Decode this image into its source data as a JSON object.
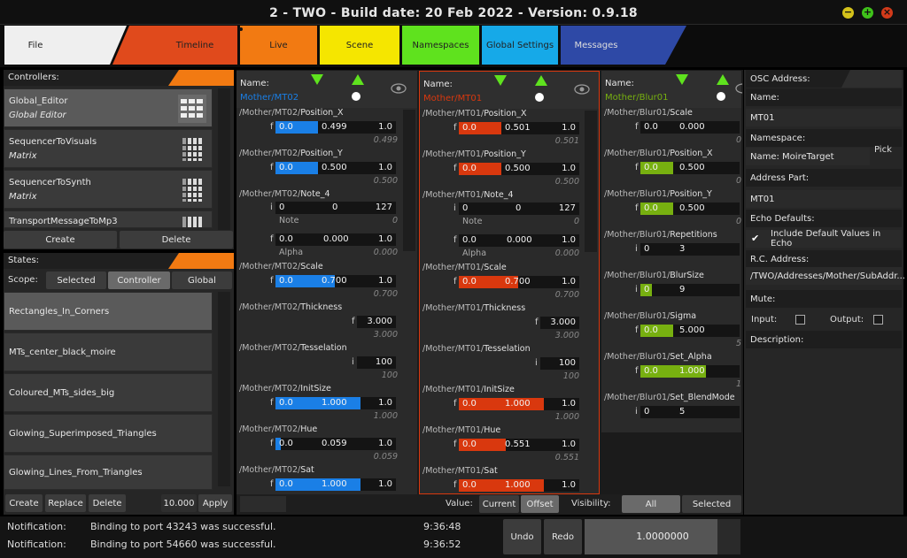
{
  "window": {
    "title": "2 - TWO - Build date: 20 Feb 2022 - Version: 0.9.18"
  },
  "tabs": [
    {
      "label": "File",
      "color": "#efefef"
    },
    {
      "label": "Timeline",
      "color": "#e04a1c"
    },
    {
      "label": "Live",
      "color": "#f27a12"
    },
    {
      "label": "Scene",
      "color": "#f5e600"
    },
    {
      "label": "Namespaces",
      "color": "#5fe21e"
    },
    {
      "label": "Global Settings",
      "color": "#16a9e8"
    },
    {
      "label": "Messages",
      "color": "#2e49a6"
    }
  ],
  "controllers": {
    "header": "Controllers:",
    "items": [
      {
        "name": "Global_Editor",
        "sub": "Global Editor"
      },
      {
        "name": "SequencerToVisuals",
        "sub": "Matrix"
      },
      {
        "name": "SequencerToSynth",
        "sub": "Matrix"
      },
      {
        "name": "TransportMessageToMp3",
        "sub": ""
      }
    ],
    "create": "Create",
    "delete": "Delete"
  },
  "states": {
    "header": "States:",
    "scope_label": "Scope:",
    "scopes": [
      "Selected",
      "Controller",
      "Global"
    ],
    "items": [
      "Rectangles_In_Corners",
      "MTs_center_black_moire",
      "Coloured_MTs_sides_big",
      "Glowing_Superimposed_Triangles",
      "Glowing_Lines_From_Triangles"
    ],
    "buttons": {
      "create": "Create",
      "replace": "Replace",
      "delete": "Delete",
      "value": "10.000",
      "apply": "Apply"
    }
  },
  "columns": [
    {
      "name_label": "Name:",
      "name": "Mother/MT02",
      "accent": "#1a7fe6",
      "params": [
        {
          "path": "/Mother/MT02/",
          "param": "Position_X",
          "type": "f",
          "min": "0.0",
          "val": "0.499",
          "max": "1.0",
          "sub": "0.499",
          "fill": 0.499
        },
        {
          "path": "/Mother/MT02/",
          "param": "Position_Y",
          "type": "f",
          "min": "0.0",
          "val": "0.500",
          "max": "1.0",
          "sub": "0.500",
          "fill": 0.5
        },
        {
          "path": "/Mother/MT02/",
          "param": "Note_4",
          "note": true
        },
        {
          "path": "/Mother/MT02/",
          "param": "Scale",
          "type": "f",
          "min": "0.0",
          "val": "0.700",
          "max": "1.0",
          "sub": "0.700",
          "fill": 0.7
        },
        {
          "path": "/Mother/MT02/",
          "param": "Thickness",
          "single": true,
          "type": "f",
          "val": "3.000",
          "sub": "3.000"
        },
        {
          "path": "/Mother/MT02/",
          "param": "Tesselation",
          "single": true,
          "type": "i",
          "val": "100",
          "sub": "100"
        },
        {
          "path": "/Mother/MT02/",
          "param": "InitSize",
          "type": "f",
          "min": "0.0",
          "val": "1.000",
          "max": "1.0",
          "sub": "1.000",
          "fill": 1.0
        },
        {
          "path": "/Mother/MT02/",
          "param": "Hue",
          "type": "f",
          "min": "0.0",
          "val": "0.059",
          "max": "1.0",
          "sub": "0.059",
          "fill": 0.059
        },
        {
          "path": "/Mother/MT02/",
          "param": "Sat",
          "type": "f",
          "min": "0.0",
          "val": "1.000",
          "max": "1.0",
          "sub": "",
          "fill": 1.0
        }
      ],
      "note": {
        "i": "i",
        "a": "0",
        "b": "0",
        "c": "127",
        "note_label": "Note",
        "note_sub": "0",
        "f": "f",
        "fa": "0.0",
        "fb": "0.000",
        "fc": "1.0",
        "alpha_label": "Alpha",
        "alpha_sub": "0.000"
      }
    },
    {
      "name_label": "Name:",
      "name": "Mother/MT01",
      "accent": "#d9380e",
      "params": [
        {
          "path": "/Mother/MT01/",
          "param": "Position_X",
          "type": "f",
          "min": "0.0",
          "val": "0.501",
          "max": "1.0",
          "sub": "0.501",
          "fill": 0.501
        },
        {
          "path": "/Mother/MT01/",
          "param": "Position_Y",
          "type": "f",
          "min": "0.0",
          "val": "0.500",
          "max": "1.0",
          "sub": "0.500",
          "fill": 0.5
        },
        {
          "path": "/Mother/MT01/",
          "param": "Note_4",
          "note": true
        },
        {
          "path": "/Mother/MT01/",
          "param": "Scale",
          "type": "f",
          "min": "0.0",
          "val": "0.700",
          "max": "1.0",
          "sub": "0.700",
          "fill": 0.7
        },
        {
          "path": "/Mother/MT01/",
          "param": "Thickness",
          "single": true,
          "type": "f",
          "val": "3.000",
          "sub": "3.000"
        },
        {
          "path": "/Mother/MT01/",
          "param": "Tesselation",
          "single": true,
          "type": "i",
          "val": "100",
          "sub": "100"
        },
        {
          "path": "/Mother/MT01/",
          "param": "InitSize",
          "type": "f",
          "min": "0.0",
          "val": "1.000",
          "max": "1.0",
          "sub": "1.000",
          "fill": 1.0
        },
        {
          "path": "/Mother/MT01/",
          "param": "Hue",
          "type": "f",
          "min": "0.0",
          "val": "0.551",
          "max": "1.0",
          "sub": "0.551",
          "fill": 0.551
        },
        {
          "path": "/Mother/MT01/",
          "param": "Sat",
          "type": "f",
          "min": "0.0",
          "val": "1.000",
          "max": "1.0",
          "sub": "",
          "fill": 1.0
        }
      ],
      "note": {
        "i": "i",
        "a": "0",
        "b": "0",
        "c": "127",
        "note_label": "Note",
        "note_sub": "0",
        "f": "f",
        "fa": "0.0",
        "fb": "0.000",
        "fc": "1.0",
        "alpha_label": "Alpha",
        "alpha_sub": "0.000"
      }
    },
    {
      "name_label": "Name:",
      "name": "Mother/Blur01",
      "accent": "#77b010",
      "params": [
        {
          "path": "/Mother/Blur01/",
          "param": "Scale",
          "type": "f",
          "min": "0.0",
          "val": "0.000",
          "max": "",
          "sub": "0",
          "fill": 0.0
        },
        {
          "path": "/Mother/Blur01/",
          "param": "Position_X",
          "type": "f",
          "min": "0.0",
          "val": "0.500",
          "max": "",
          "sub": "0",
          "fill": 0.5
        },
        {
          "path": "/Mother/Blur01/",
          "param": "Position_Y",
          "type": "f",
          "min": "0.0",
          "val": "0.500",
          "max": "",
          "sub": "0",
          "fill": 0.5
        },
        {
          "path": "/Mother/Blur01/",
          "param": "Repetitions",
          "type": "i",
          "min": "0",
          "val": "3",
          "max": "",
          "sub": "",
          "fill": 0.0
        },
        {
          "path": "/Mother/Blur01/",
          "param": "BlurSize",
          "type": "i",
          "min": "0",
          "val": "9",
          "max": "",
          "sub": "",
          "fill": 0.18
        },
        {
          "path": "/Mother/Blur01/",
          "param": "Sigma",
          "type": "f",
          "min": "0.0",
          "val": "5.000",
          "max": "",
          "sub": "5",
          "fill": 0.5
        },
        {
          "path": "/Mother/Blur01/",
          "param": "Set_Alpha",
          "type": "f",
          "min": "0.0",
          "val": "1.000",
          "max": "",
          "sub": "1",
          "fill": 1.0
        },
        {
          "path": "/Mother/Blur01/",
          "param": "Set_BlendMode",
          "type": "i",
          "min": "0",
          "val": "5",
          "max": "",
          "sub": "",
          "fill": 0.0
        }
      ]
    }
  ],
  "bottom_controls": {
    "value_label": "Value:",
    "current": "Current",
    "offset": "Offset",
    "visibility_label": "Visibility:",
    "all": "All",
    "selected": "Selected"
  },
  "notifications": [
    {
      "label": "Notification:",
      "text": "Binding to port 43243 was successful.",
      "time": "9:36:48"
    },
    {
      "label": "Notification:",
      "text": "Binding to port 54660 was successful.",
      "time": "9:36:52"
    }
  ],
  "undo": "Undo",
  "redo": "Redo",
  "zoom": {
    "value": "1.0000000",
    "fill": 0.85
  },
  "inspector": {
    "osc_label": "OSC Address:",
    "name_label": "Name:",
    "name_value": "MT01",
    "namespace_label": "Namespace:",
    "pick": "Pick",
    "namespace_value": "Name:  MoireTarget",
    "address_part_label": "Address Part:",
    "address_part_value": "MT01",
    "echo_label": "Echo Defaults:",
    "echo_check": "Include Default Values in Echo",
    "rc_label": "R.C. Address:",
    "rc_value": "/TWO/Addresses/Mother/SubAddr...",
    "mute_label": "Mute:",
    "input_label": "Input:",
    "output_label": "Output:",
    "description_label": "Description:"
  }
}
